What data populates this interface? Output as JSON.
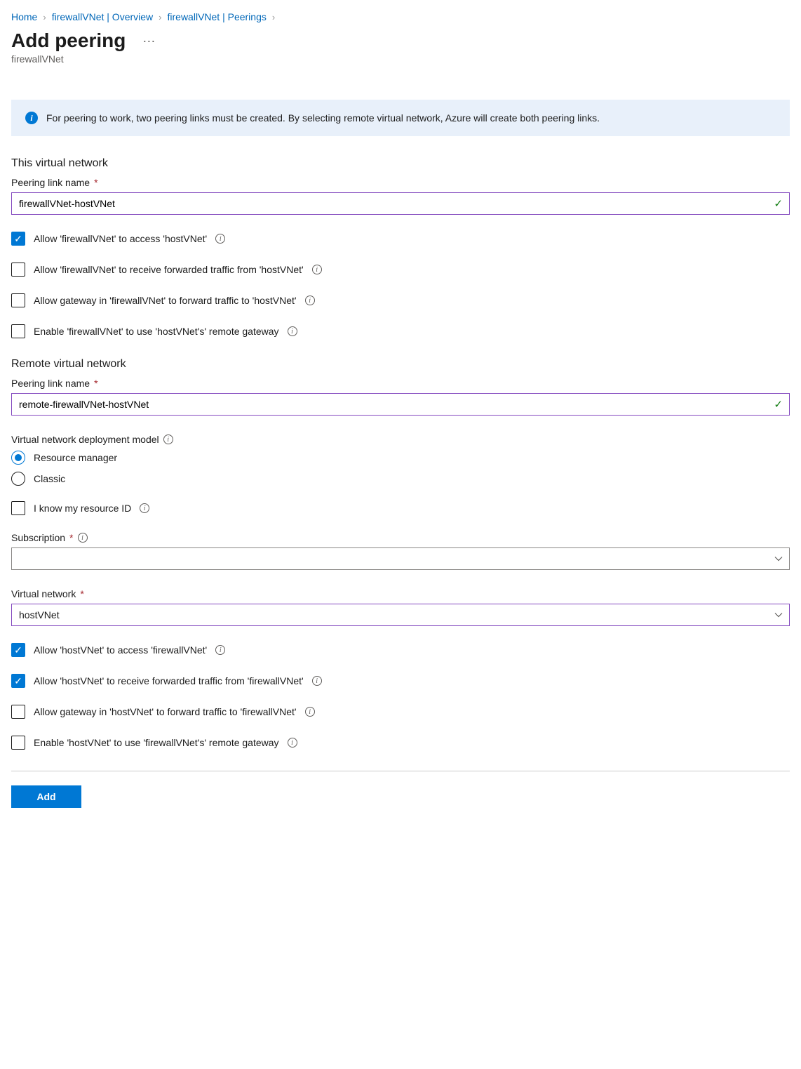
{
  "breadcrumbs": [
    {
      "label": "Home"
    },
    {
      "label": "firewallVNet | Overview"
    },
    {
      "label": "firewallVNet | Peerings"
    }
  ],
  "header": {
    "title": "Add peering",
    "subtitle": "firewallVNet"
  },
  "info_banner": {
    "text": "For peering to work, two peering links must be created. By selecting remote virtual network, Azure will create both peering links."
  },
  "this_vnet": {
    "section_title": "This virtual network",
    "peering_link_name_label": "Peering link name",
    "peering_link_name_value": "firewallVNet-hostVNet",
    "checks": [
      {
        "label": "Allow 'firewallVNet' to access 'hostVNet'",
        "checked": true
      },
      {
        "label": "Allow 'firewallVNet' to receive forwarded traffic from 'hostVNet'",
        "checked": false
      },
      {
        "label": "Allow gateway in 'firewallVNet' to forward traffic to 'hostVNet'",
        "checked": false
      },
      {
        "label": "Enable 'firewallVNet' to use 'hostVNet's' remote gateway",
        "checked": false
      }
    ]
  },
  "remote_vnet": {
    "section_title": "Remote virtual network",
    "peering_link_name_label": "Peering link name",
    "peering_link_name_value": "remote-firewallVNet-hostVNet",
    "deployment_model_label": "Virtual network deployment model",
    "deployment_model_options": [
      {
        "label": "Resource manager",
        "checked": true
      },
      {
        "label": "Classic",
        "checked": false
      }
    ],
    "know_resource_id": {
      "label": "I know my resource ID",
      "checked": false
    },
    "subscription_label": "Subscription",
    "subscription_value": "",
    "virtual_network_label": "Virtual network",
    "virtual_network_value": "hostVNet",
    "checks": [
      {
        "label": "Allow 'hostVNet' to access 'firewallVNet'",
        "checked": true
      },
      {
        "label": "Allow 'hostVNet' to receive forwarded traffic from 'firewallVNet'",
        "checked": true
      },
      {
        "label": "Allow gateway in 'hostVNet' to forward traffic to 'firewallVNet'",
        "checked": false
      },
      {
        "label": "Enable 'hostVNet' to use 'firewallVNet's' remote gateway",
        "checked": false
      }
    ]
  },
  "footer": {
    "add_label": "Add"
  }
}
